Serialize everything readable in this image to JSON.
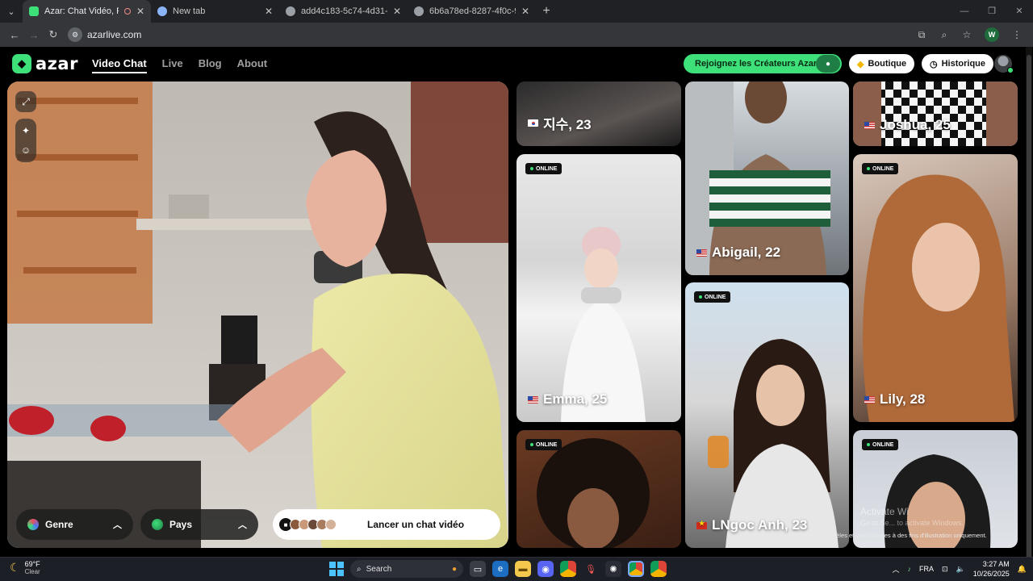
{
  "browser": {
    "tabs": [
      {
        "title": "Azar: Chat Vidéo, Rencontr",
        "active": true,
        "favicon_color": "#3ee07a",
        "recording": true
      },
      {
        "title": "New tab",
        "active": false,
        "favicon_color": "#8ab4f8"
      },
      {
        "title": "add4c183-5c74-4d31-8721-f25",
        "active": false,
        "favicon_color": "#9aa0a6"
      },
      {
        "title": "6b6a78ed-8287-4f0c-9d53-e4f",
        "active": false,
        "favicon_color": "#9aa0a6"
      }
    ],
    "url": "azarlive.com",
    "profile_initial": "W"
  },
  "site": {
    "logo_text": "azar",
    "nav": [
      "Video Chat",
      "Live",
      "Blog",
      "About"
    ],
    "nav_active": "Video Chat",
    "creators_label": "Rejoignez les Créateurs Azar",
    "boutique_label": "Boutique",
    "historique_label": "Historique",
    "accent_color": "#3ee07a"
  },
  "controls": {
    "genre_label": "Genre",
    "pays_label": "Pays",
    "start_label": "Lancer un chat vidéo"
  },
  "profiles": {
    "jisu": {
      "name": "지수, 23",
      "flag": "kr"
    },
    "joshua": {
      "name": "Joshua, 25",
      "flag": "us"
    },
    "abigail": {
      "name": "Abigail, 22",
      "flag": "us"
    },
    "emma": {
      "name": "Emma, 25",
      "flag": "us",
      "badge": "ONLINE"
    },
    "lily": {
      "name": "Lily, 28",
      "flag": "us",
      "badge": "ONLINE"
    },
    "lngoc": {
      "name": "LNgoc Anh, 23",
      "flag": "vn",
      "badge": "ONLINE"
    },
    "col1_bottom": {
      "badge": "ONLINE"
    },
    "col3_bottom": {
      "badge": "ONLINE"
    }
  },
  "disclaimer": "Toutes les images sont des modèles et sont utilisées à des fins d'illustration uniquement.",
  "watermark": {
    "line1": "Activate Wi",
    "line2": "Go to Se...  to activate Windows."
  },
  "taskbar": {
    "weather_temp": "69°F",
    "weather_desc": "Clear",
    "search_placeholder": "Search",
    "language": "FRA",
    "time": "3:27 AM",
    "date": "10/26/2025"
  }
}
